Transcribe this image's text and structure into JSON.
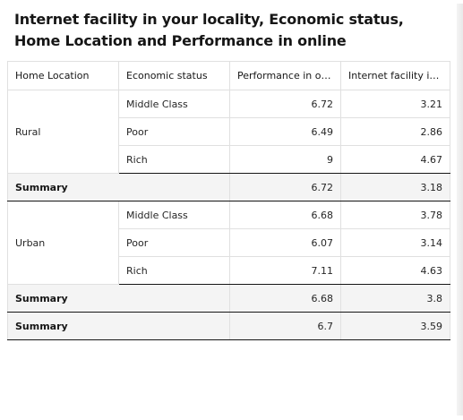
{
  "title": "Internet facility in your locality, Economic status, Home Location and Performance in online",
  "columns": [
    "Home Location",
    "Economic status",
    "Performance in on...",
    "Internet facility in..."
  ],
  "groups": [
    {
      "location": "Rural",
      "rows": [
        {
          "status": "Middle Class",
          "performance": "6.72",
          "internet": "3.21"
        },
        {
          "status": "Poor",
          "performance": "6.49",
          "internet": "2.86"
        },
        {
          "status": "Rich",
          "performance": "9",
          "internet": "4.67"
        }
      ],
      "summary": {
        "label": "Summary",
        "performance": "6.72",
        "internet": "3.18"
      }
    },
    {
      "location": "Urban",
      "rows": [
        {
          "status": "Middle Class",
          "performance": "6.68",
          "internet": "3.78"
        },
        {
          "status": "Poor",
          "performance": "6.07",
          "internet": "3.14"
        },
        {
          "status": "Rich",
          "performance": "7.11",
          "internet": "4.63"
        }
      ],
      "summary": {
        "label": "Summary",
        "performance": "6.68",
        "internet": "3.8"
      }
    }
  ],
  "grand_summary": {
    "label": "Summary",
    "performance": "6.7",
    "internet": "3.59"
  }
}
